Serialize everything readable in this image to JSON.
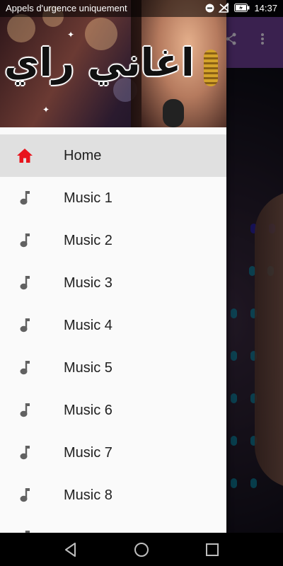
{
  "status_bar": {
    "notice": "Appels d'urgence uniquement",
    "time": "14:37",
    "icons": [
      "dnd-icon",
      "signal-off-icon",
      "battery-icon"
    ]
  },
  "drawer": {
    "header": {
      "title": "اغاني راي"
    },
    "items": [
      {
        "label": "Home",
        "icon": "home-icon",
        "active": true
      },
      {
        "label": "Music 1",
        "icon": "music-note-icon"
      },
      {
        "label": "Music 2",
        "icon": "music-note-icon"
      },
      {
        "label": "Music 3",
        "icon": "music-note-icon"
      },
      {
        "label": "Music 4",
        "icon": "music-note-icon"
      },
      {
        "label": "Music 5",
        "icon": "music-note-icon"
      },
      {
        "label": "Music 6",
        "icon": "music-note-icon"
      },
      {
        "label": "Music 7",
        "icon": "music-note-icon"
      },
      {
        "label": "Music 8",
        "icon": "music-note-icon"
      }
    ]
  },
  "toolbar": {
    "icons": [
      "share-icon",
      "more-vert-icon"
    ]
  },
  "nav_bar": {
    "buttons": [
      "back-icon",
      "home-circle-icon",
      "recents-icon"
    ]
  },
  "colors": {
    "accent": "#e8141c",
    "toolbar": "#6a3d91",
    "active_item_bg": "#e0e0e0",
    "icon_grey": "#616161"
  }
}
